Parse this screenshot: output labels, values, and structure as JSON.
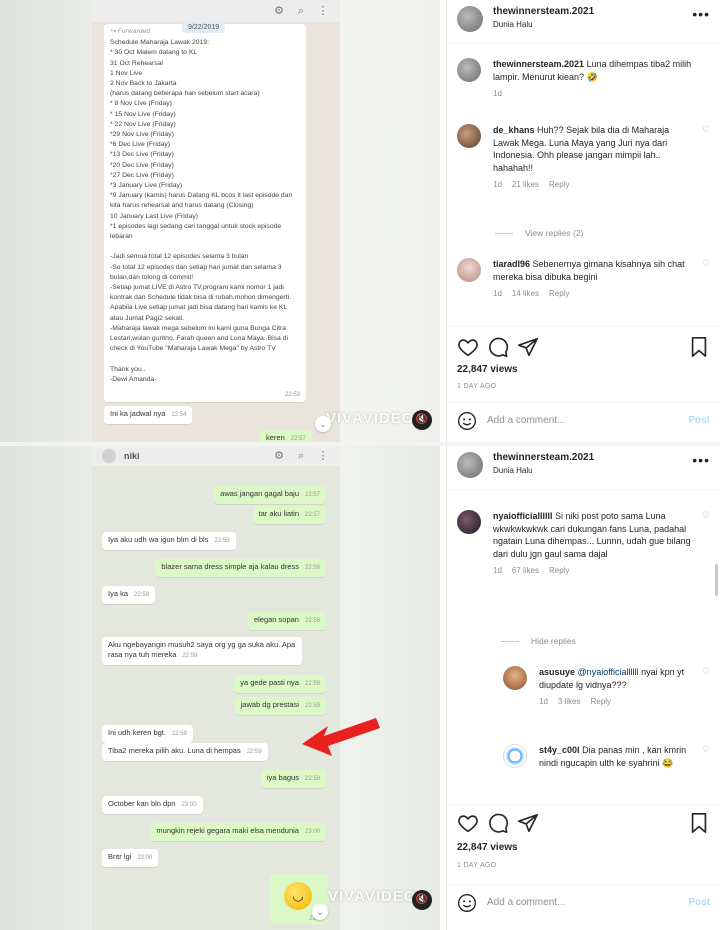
{
  "top_chat": {
    "date_badge": "9/22/2019",
    "forwarded_label": "Forwarded",
    "forwarded_body": "Schedule Maharaja Lawak 2019:\n* 30 Oct Malem datang to KL\n   31 Oct Rehearsal\n   1 Nov Live\n   2 Nov Back to Jakarta\n   (harus datang beberapa hari sebelum start acara)\n* 8 Nov Live (Friday)\n* 15 Nov Live (Friday)\n* 22 Nov Live (Friday)\n*29 Nov Live (Friday)\n*6 Dec Live (Friday)\n*13 Dec Live (Friday)\n*20 Dec Live (Friday)\n*27 Dec Live (Friday)\n*3 January Live (Friday)\n*9 January (kamis) harus Datang KL bcos it last episode dan kita harus rehearsal and harus datang (Closing)\n10 January Last Live (Friday)\n*1 episodes lagi sedang cari tanggal untuk stock episode lebaran\n\n-Jadi semua total 12 episodes selama 3 bulan\n-So total 12 episodes dan setiap hari jumat dan selama 3 bulan,dan tolong di commit!\n-Setiap jumat LIVE di Astro TV,program kami nomor 1 jadi kontrak dan Schedule tidak bisa di rubah,mohon dimengerti.\nApabila Live setiap jumat jadi bisa datang hari kamis ke KL atau Jumat Pagi2 sekali.\n-Maharaja lawak mega sebelum ini kami guna Bunga Citra Lestari,wulan guritno, Farah queen and Luna Maya..Bisa di check di YouTube \"Maharaja Lawak Mega\" by Astro TV\n\nThank you..\n-Dewi Amanda-",
    "forwarded_time": "22:53",
    "msg1_text": "Ini ka jadwal nya",
    "msg1_time": "22:54",
    "msg2_text": "keren",
    "msg2_time": "22:57"
  },
  "bottom_chat": {
    "contact_name": "niki",
    "messages": [
      {
        "dir": "out",
        "text": "awas jangan gagal baju",
        "time": "22:57"
      },
      {
        "dir": "out",
        "text": "tar aku liatin",
        "time": "22:57"
      },
      {
        "dir": "in",
        "text": "Iya aku udh wa igun blm di bls",
        "time": "22:58"
      },
      {
        "dir": "out",
        "text": "blazer sama dress simple aja kalau dress",
        "time": "22:58"
      },
      {
        "dir": "in",
        "text": "Iya ka",
        "time": "22:58"
      },
      {
        "dir": "out",
        "text": "elegan sopan",
        "time": "22:58"
      },
      {
        "dir": "in",
        "text": "Aku ngebayangin musuh2 saya org yg ga suka aku. Apa rasa nya tuh mereka",
        "time": "22:58"
      },
      {
        "dir": "out",
        "text": "ya gede pasti nya",
        "time": "22:59"
      },
      {
        "dir": "out",
        "text": "jawab dg prestasi",
        "time": "22:59"
      },
      {
        "dir": "in",
        "text": "Ini udh keren bgt.",
        "time": "22:59"
      },
      {
        "dir": "in",
        "text": "Tiba2 mereka pilih aku. Luna di hempas",
        "time": "22:59"
      },
      {
        "dir": "out",
        "text": "iya bagus",
        "time": "22:59"
      },
      {
        "dir": "in",
        "text": "October kan bln dpn",
        "time": "23:00"
      },
      {
        "dir": "out",
        "text": "mungkin rejeki gegara maki elsa mendunia",
        "time": "23:00"
      },
      {
        "dir": "in",
        "text": "Bntr lgi",
        "time": "23:00"
      }
    ],
    "sticker_time": "23:00"
  },
  "watermark": "VIVAVIDEO",
  "ig_top": {
    "username": "thewinnersteam.2021",
    "location": "Dunia Halu",
    "caption_user": "thewinnersteam.2021",
    "caption_text": "Luna dihempas tiba2 milih lampir. Menurut kiean? 🤣",
    "caption_age": "1d",
    "comments": [
      {
        "user": "de_khans",
        "text": "Huh?? Sejak bila dia di Maharaja Lawak Mega. Luna Maya yang Juri nya dari Indonesia. Ohh please jangan mimpii lah.. hahahah!!",
        "age": "1d",
        "likes": "21 likes",
        "reply": "Reply"
      },
      {
        "user": "tiaradl96",
        "text": "Sebenernya gimana kisahnya sih chat mereka bisa dibuka begini",
        "age": "1d",
        "likes": "14 likes",
        "reply": "Reply"
      }
    ],
    "view_replies": "View replies (2)",
    "views": "22,847 views",
    "posted": "1 DAY AGO",
    "add_comment": "Add a comment...",
    "post_button": "Post"
  },
  "ig_bottom": {
    "username": "thewinnersteam.2021",
    "location": "Dunia Halu",
    "comment1": {
      "user": "nyaiofficiallllll",
      "text": "Si niki post poto sama Luna wkwkwkwkwk cari dukungan fans Luna, padahal ngatain Luna dihempas... Lunnn, udah gue bilang dari dulu jgn gaul sama dajal",
      "age": "1d",
      "likes": "67 likes",
      "reply": "Reply"
    },
    "hide_replies": "Hide replies",
    "reply1": {
      "user": "asusuye",
      "mention": "@nyaiofficiallllll",
      "text": "nyai kpn yt diupdate lg vidnya???",
      "age": "1d",
      "likes": "3 likes",
      "reply": "Reply"
    },
    "reply2": {
      "user": "st4y_c00l",
      "text": "Dia panas min , kan kmrin nindi ngucapin ulth ke syahrini 😂"
    },
    "views": "22,847 views",
    "posted": "1 DAY AGO",
    "add_comment": "Add a comment...",
    "post_button": "Post"
  },
  "colors": {
    "incoming": "#ffffff",
    "outgoing": "#dcf8c6",
    "arrow": "#e8211f",
    "post_disabled": "#b3dbff"
  }
}
